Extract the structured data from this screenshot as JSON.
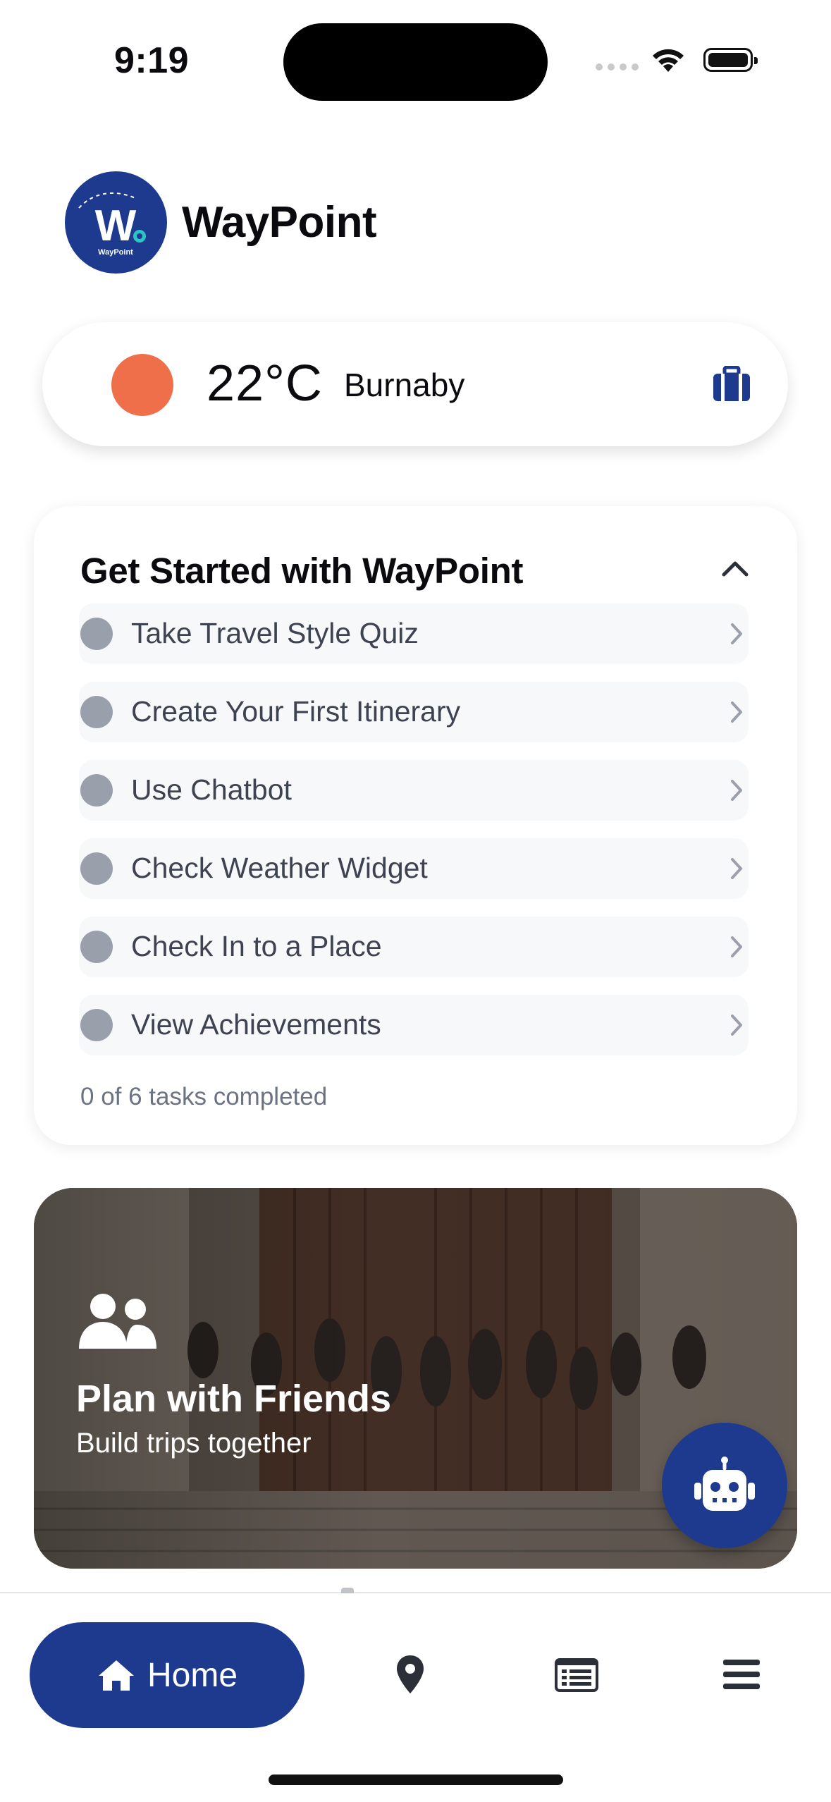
{
  "status_bar": {
    "time": "9:19"
  },
  "header": {
    "app_title": "WayPoint",
    "logo_text": "W",
    "logo_subtext": "WayPoint"
  },
  "weather": {
    "temperature": "22°C",
    "city": "Burnaby"
  },
  "get_started": {
    "title": "Get Started with WayPoint",
    "tasks": [
      {
        "label": "Take Travel Style Quiz"
      },
      {
        "label": "Create Your First Itinerary"
      },
      {
        "label": "Use Chatbot"
      },
      {
        "label": "Check Weather Widget"
      },
      {
        "label": "Check In to a Place"
      },
      {
        "label": "View Achievements"
      }
    ],
    "progress_text": "0 of 6 tasks completed",
    "completed": 0,
    "total": 6
  },
  "banner": {
    "title": "Plan with Friends",
    "subtitle": "Build trips together"
  },
  "tab_bar": {
    "home_label": "Home"
  },
  "colors": {
    "brand": "#1d3a8f",
    "sun": "#ef6f4a",
    "task_dot": "#9aa0ab"
  }
}
